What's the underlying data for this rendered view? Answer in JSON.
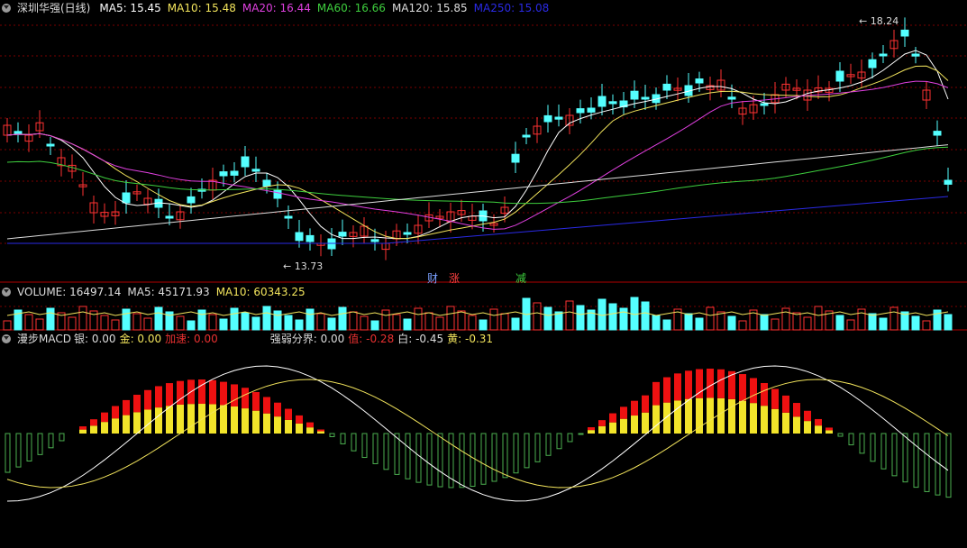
{
  "stock": {
    "name": "深圳华强(日线)"
  },
  "ma_legend": [
    {
      "label": "MA5: 15.45",
      "color": "#ffffff"
    },
    {
      "label": "MA10: 15.48",
      "color": "#f2e45c"
    },
    {
      "label": "MA20: 16.44",
      "color": "#e040e0"
    },
    {
      "label": "MA60: 16.66",
      "color": "#3ecf3e"
    },
    {
      "label": "MA120: 15.85",
      "color": "#dddddd"
    },
    {
      "label": "MA250: 15.08",
      "color": "#2a2ae6"
    }
  ],
  "price_annotations": {
    "high": "18.24",
    "low": "13.73"
  },
  "event_markers": {
    "cai": "财",
    "zhang": "涨",
    "jian": "减"
  },
  "volume_legend": [
    {
      "label": "VOLUME: 16497.14",
      "color": "#dddddd"
    },
    {
      "label": "MA5: 45171.93",
      "color": "#dddddd"
    },
    {
      "label": "MA10: 60343.25",
      "color": "#f2e45c"
    }
  ],
  "macd_legend": [
    {
      "label": "漫步MACD",
      "color": "#dddddd"
    },
    {
      "label": "银: 0.00",
      "color": "#dddddd"
    },
    {
      "label": "金: 0.00",
      "color": "#f2e45c"
    },
    {
      "label": "加速: 0.00",
      "color": "#e83030"
    },
    {
      "label": "强弱分界: 0.00",
      "color": "#dddddd"
    },
    {
      "label": "值: -0.28",
      "color": "#e83030"
    },
    {
      "label": "白: -0.45",
      "color": "#dddddd"
    },
    {
      "label": "黄: -0.31",
      "color": "#f2e45c"
    }
  ],
  "colors": {
    "up": "#ff3232",
    "down": "#54ffff",
    "grid": "#7a0000",
    "divider": "#b00000"
  }
}
